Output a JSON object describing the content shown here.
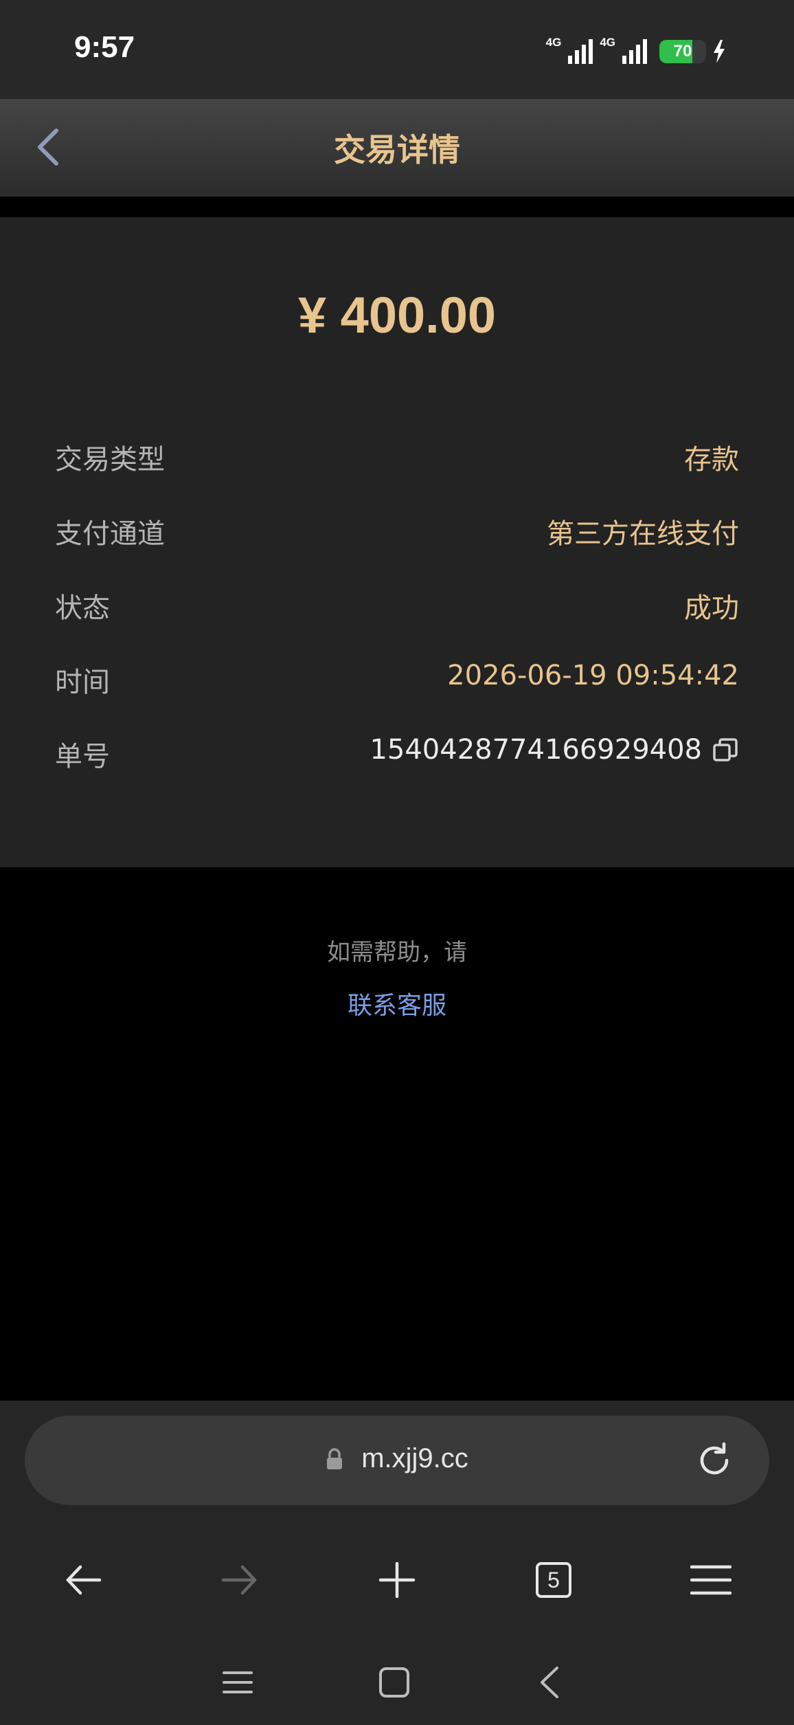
{
  "status_bar": {
    "time": "9:57",
    "network_1": "4G",
    "network_2": "4G",
    "battery_level": "70",
    "battery_fraction": 0.7
  },
  "header": {
    "title": "交易详情"
  },
  "transaction": {
    "amount": "¥ 400.00",
    "rows": [
      {
        "label": "交易类型",
        "value": "存款"
      },
      {
        "label": "支付通道",
        "value": "第三方在线支付"
      },
      {
        "label": "状态",
        "value": "成功"
      },
      {
        "label": "时间",
        "value": "2026-06-19 09:54:42"
      },
      {
        "label": "单号",
        "value": "1540428774166929408"
      }
    ]
  },
  "help": {
    "text": "如需帮助，请",
    "link": "联系客服"
  },
  "browser": {
    "url": "m.xjj9.cc",
    "tab_count": "5"
  },
  "colors": {
    "accent_gold": "#e8c48e",
    "link_blue": "#7a9fe6",
    "battery_green": "#2fbf4a"
  },
  "icons": [
    "back-chevron-icon",
    "copy-icon",
    "lock-icon",
    "reload-icon",
    "arrow-left-icon",
    "arrow-right-icon",
    "plus-icon",
    "menu-icon",
    "recent-apps-icon",
    "home-icon",
    "system-back-icon"
  ]
}
